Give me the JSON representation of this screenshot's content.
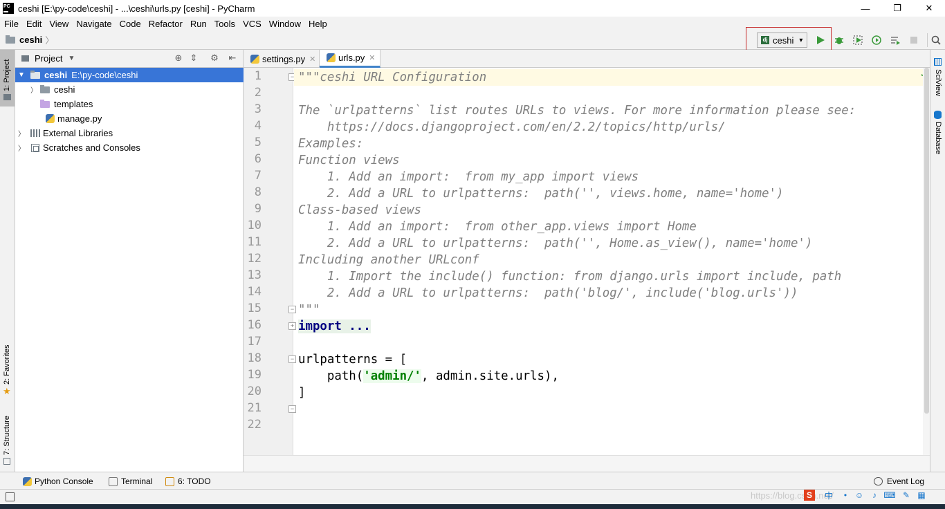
{
  "window": {
    "title": "ceshi [E:\\py-code\\ceshi] - ...\\ceshi\\urls.py [ceshi] - PyCharm",
    "logo_text": "PC",
    "controls": [
      "—",
      "❐",
      "✕"
    ]
  },
  "menu": [
    "File",
    "Edit",
    "View",
    "Navigate",
    "Code",
    "Refactor",
    "Run",
    "Tools",
    "VCS",
    "Window",
    "Help"
  ],
  "navbar": {
    "project": "ceshi",
    "run_config": "ceshi",
    "run_config_icon": "dj"
  },
  "left_stripe": {
    "project_tab": "1: Project",
    "favorites_tab": "2: Favorites",
    "structure_tab": "7: Structure"
  },
  "project_panel": {
    "title": "Project",
    "tree": [
      {
        "name": "ceshi",
        "path": "E:\\py-code\\ceshi",
        "icon": "folder-icon",
        "selected": true
      },
      {
        "name": "ceshi",
        "icon": "folder-icon"
      },
      {
        "name": "templates",
        "icon": "folder-purple-icon"
      },
      {
        "name": "manage.py",
        "icon": "python-file-icon"
      },
      {
        "name": "External Libraries",
        "icon": "library-icon"
      },
      {
        "name": "Scratches and Consoles",
        "icon": "scratch-icon"
      }
    ]
  },
  "editor": {
    "tabs": [
      {
        "label": "settings.py",
        "active": false
      },
      {
        "label": "urls.py",
        "active": true
      }
    ],
    "line_numbers": [
      "1",
      "2",
      "3",
      "4",
      "5",
      "6",
      "7",
      "8",
      "9",
      "10",
      "11",
      "12",
      "13",
      "14",
      "15",
      "16",
      "17",
      "18",
      "19",
      "20",
      "21",
      "22"
    ],
    "code_lines": [
      "\"\"\"ceshi URL Configuration",
      "",
      "The `urlpatterns` list routes URLs to views. For more information please see:",
      "    https://docs.djangoproject.com/en/2.2/topics/http/urls/",
      "Examples:",
      "Function views",
      "    1. Add an import:  from my_app import views",
      "    2. Add a URL to urlpatterns:  path('', views.home, name='home')",
      "Class-based views",
      "    1. Add an import:  from other_app.views import Home",
      "    2. Add a URL to urlpatterns:  path('', Home.as_view(), name='home')",
      "Including another URLconf",
      "    1. Import the include() function: from django.urls import include, path",
      "    2. Add a URL to urlpatterns:  path('blog/', include('blog.urls'))",
      "\"\"\"",
      "import ...",
      "",
      "urlpatterns = [",
      "    path(",
      "'admin/'",
      ", admin.site.urls),",
      "]"
    ]
  },
  "right_stripe": {
    "sciview_tab": "SciView",
    "database_tab": "Database"
  },
  "bottom_tools": {
    "python_console": "Python Console",
    "terminal": "Terminal",
    "todo": "6: TODO",
    "event_log": "Event Log"
  },
  "watermark": "https://blog.csdn.net/"
}
